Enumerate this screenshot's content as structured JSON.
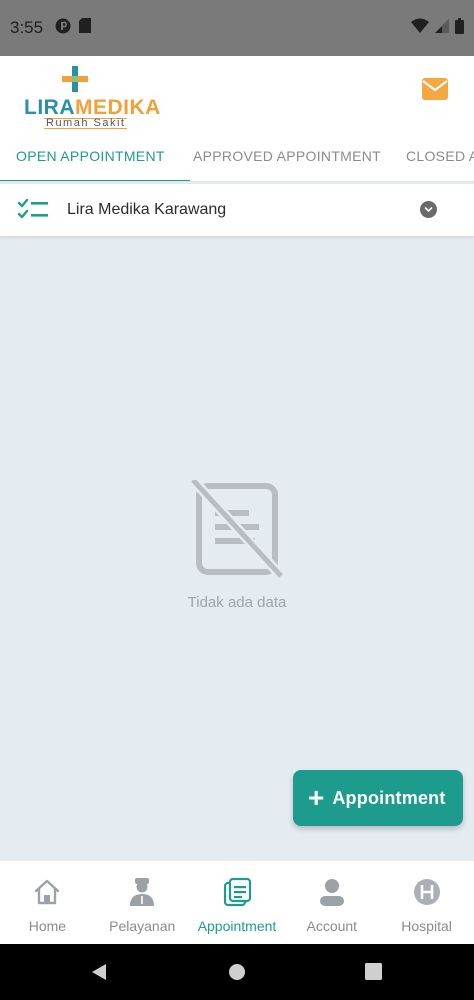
{
  "status_bar": {
    "time": "3:55"
  },
  "header": {
    "logo": {
      "brand_first": "LIRA",
      "brand_second": "MEDIKA",
      "subtitle": "Rumah Sakit"
    },
    "mail_icon": "mail-icon"
  },
  "tabs": [
    {
      "label": "OPEN APPOINTMENT",
      "active": true
    },
    {
      "label": "APPROVED APPOINTMENT",
      "active": false
    },
    {
      "label": "CLOSED A",
      "active": false
    }
  ],
  "hospital_selector": {
    "icon": "checklist-icon",
    "label": "Lira Medika Karawang"
  },
  "empty_state": {
    "icon": "no-document-icon",
    "message": "Tidak ada data"
  },
  "fab": {
    "plus": "+",
    "label": "Appointment"
  },
  "bottom_nav": [
    {
      "label": "Home",
      "icon": "home-icon",
      "active": false
    },
    {
      "label": "Pelayanan",
      "icon": "doctor-icon",
      "active": false
    },
    {
      "label": "Appointment",
      "icon": "appointment-icon",
      "active": true
    },
    {
      "label": "Account",
      "icon": "person-icon",
      "active": false
    },
    {
      "label": "Hospital",
      "icon": "hospital-icon",
      "active": false
    }
  ],
  "colors": {
    "accent": "#1d9c8e",
    "brand_blue": "#2a8fa8",
    "brand_orange": "#f2a03a",
    "background": "#e4ebf1"
  }
}
